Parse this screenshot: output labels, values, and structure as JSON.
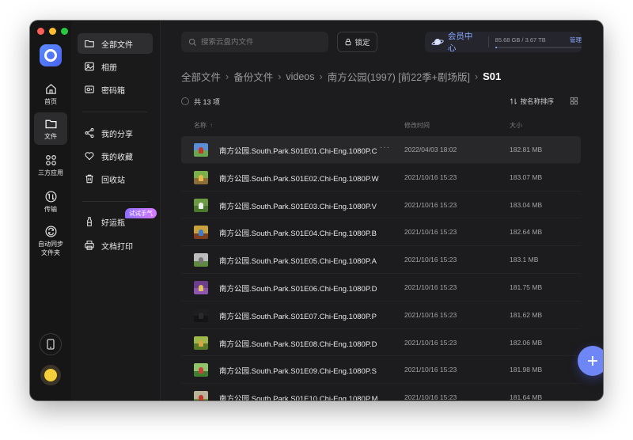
{
  "window": {
    "traffic_colors": [
      "#ff5f57",
      "#febc2e",
      "#28c840"
    ]
  },
  "rail": {
    "items": [
      {
        "label": "首页",
        "icon": "home-icon"
      },
      {
        "label": "文件",
        "icon": "folder-icon",
        "active": true
      },
      {
        "label": "三方应用",
        "icon": "apps-icon"
      },
      {
        "label": "传输",
        "icon": "transfer-icon"
      },
      {
        "label": "自动同步\n文件夹",
        "icon": "sync-folder-icon"
      }
    ]
  },
  "sidebar": {
    "items": [
      {
        "label": "全部文件",
        "icon": "folder-icon",
        "active": true
      },
      {
        "label": "相册",
        "icon": "photo-icon"
      },
      {
        "label": "密码箱",
        "icon": "safe-icon"
      },
      {
        "label": "我的分享",
        "icon": "share-icon"
      },
      {
        "label": "我的收藏",
        "icon": "heart-icon"
      },
      {
        "label": "回收站",
        "icon": "trash-icon"
      },
      {
        "label": "好运瓶",
        "icon": "bottle-icon"
      },
      {
        "label": "文档打印",
        "icon": "printer-icon"
      }
    ],
    "try_badge": "试试手气"
  },
  "header": {
    "search_placeholder": "搜索云盘内文件",
    "lock_label": "锁定",
    "vip_title": "会员中心",
    "storage_text": "85.68 GB / 3.67 TB",
    "storage_used_fraction": 0.023,
    "manage_label": "管理",
    "accent": "#8aa8ff"
  },
  "breadcrumbs": [
    "全部文件",
    "备份文件",
    "videos",
    "南方公园(1997) [前22季+剧场版]"
  ],
  "breadcrumb_current": "S01",
  "toolbar": {
    "count_label": "共 13 项",
    "sort_label": "按名称排序"
  },
  "columns": {
    "name": "名称",
    "mtime": "修改时间",
    "size": "大小"
  },
  "files": [
    {
      "name": "南方公园.South.Park.S01E01.Chi-Eng.1080P.C",
      "mtime": "2022/04/03 18:02",
      "size": "182.81 MB",
      "sky": "#5a8fd8",
      "ground": "#6aa84f",
      "fig": "#c0392b"
    },
    {
      "name": "南方公园.South.Park.S01E02.Chi-Eng.1080P.W",
      "mtime": "2021/10/16 15:23",
      "size": "183.07 MB",
      "sky": "#7ab04a",
      "ground": "#8c6d3a",
      "fig": "#e6b84a"
    },
    {
      "name": "南方公园.South.Park.S01E03.Chi-Eng.1080P.V",
      "mtime": "2021/10/16 15:23",
      "size": "183.04 MB",
      "sky": "#6b9c43",
      "ground": "#4a7a2e",
      "fig": "#f0f0f0"
    },
    {
      "name": "南方公园.South.Park.S01E04.Chi-Eng.1080P.B",
      "mtime": "2021/10/16 15:23",
      "size": "182.64 MB",
      "sky": "#c9a23c",
      "ground": "#7d3f1d",
      "fig": "#3b7bd1"
    },
    {
      "name": "南方公园.South.Park.S01E05.Chi-Eng.1080P.A",
      "mtime": "2021/10/16 15:23",
      "size": "183.1 MB",
      "sky": "#bcbcbc",
      "ground": "#5d8a3c",
      "fig": "#777777"
    },
    {
      "name": "南方公园.South.Park.S01E06.Chi-Eng.1080P.D",
      "mtime": "2021/10/16 15:23",
      "size": "181.75 MB",
      "sky": "#6b3d8a",
      "ground": "#8e56b0",
      "fig": "#e0c25a"
    },
    {
      "name": "南方公园.South.Park.S01E07.Chi-Eng.1080P.P",
      "mtime": "2021/10/16 15:23",
      "size": "181.62 MB",
      "sky": "#1e1e20",
      "ground": "#141416",
      "fig": "#2a2a2c"
    },
    {
      "name": "南方公园.South.Park.S01E08.Chi-Eng.1080P.D",
      "mtime": "2021/10/16 15:23",
      "size": "182.06 MB",
      "sky": "#9fb84c",
      "ground": "#567a28",
      "fig": "#d9a441"
    },
    {
      "name": "南方公园.South.Park.S01E09.Chi-Eng.1080P.S",
      "mtime": "2021/10/16 15:23",
      "size": "181.98 MB",
      "sky": "#8fc46b",
      "ground": "#3f7f2f",
      "fig": "#c7433c"
    },
    {
      "name": "南方公园.South.Park.S01E10.Chi-Eng.1080P.M",
      "mtime": "2021/10/16 15:23",
      "size": "181.64 MB",
      "sky": "#b9b39a",
      "ground": "#6c8e3b",
      "fig": "#c0392b"
    }
  ]
}
